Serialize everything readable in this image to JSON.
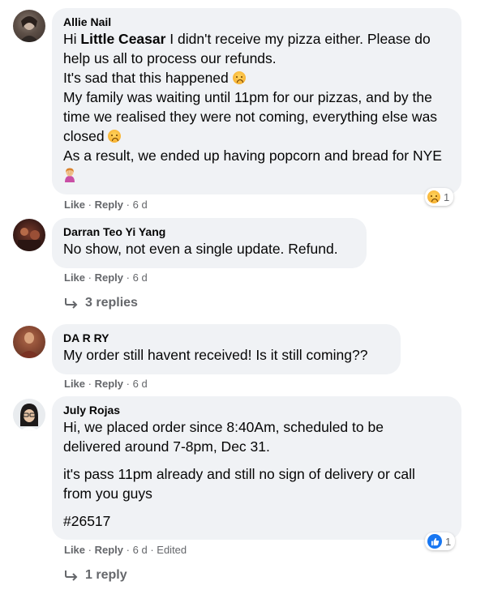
{
  "comments": [
    {
      "author": "Allie Nail",
      "text_pre": "Hi ",
      "mention": "Little Ceasar",
      "line1_rest": " I didn't receive my pizza either. Please do help us all to process our refunds.",
      "line2": "It's sad that this happened",
      "line3": "My family was waiting until 11pm for our pizzas, and by the time we realised they were not coming, everything else was closed",
      "line4": "As a result, we ended up having popcorn and bread for NYE",
      "like": "Like",
      "reply": "Reply",
      "time": "6 d",
      "reaction_count": "1",
      "reaction_icon": "sad-face-icon"
    },
    {
      "author": "Darran Teo Yi Yang",
      "text": "No show, not even a single update. Refund.",
      "like": "Like",
      "reply": "Reply",
      "time": "6 d",
      "replies_label": "3 replies"
    },
    {
      "author": "DA R RY",
      "text": "My order still havent received! Is it still coming??",
      "like": "Like",
      "reply": "Reply",
      "time": "6 d"
    },
    {
      "author": "July Rojas",
      "para1": "Hi, we placed order since 8:40Am, scheduled to be delivered around 7-8pm, Dec 31.",
      "para2": "it's pass 11pm already and still no sign of delivery or call from you guys",
      "para3": "#26517",
      "like": "Like",
      "reply": "Reply",
      "time": "6 d",
      "edited": "Edited",
      "reaction_count": "1",
      "reaction_icon": "like-icon",
      "replies_label": "1 reply"
    }
  ],
  "separator": "·",
  "colors": {
    "bubble": "#f0f2f5",
    "meta": "#65676b",
    "like_blue": "#1877f2"
  }
}
